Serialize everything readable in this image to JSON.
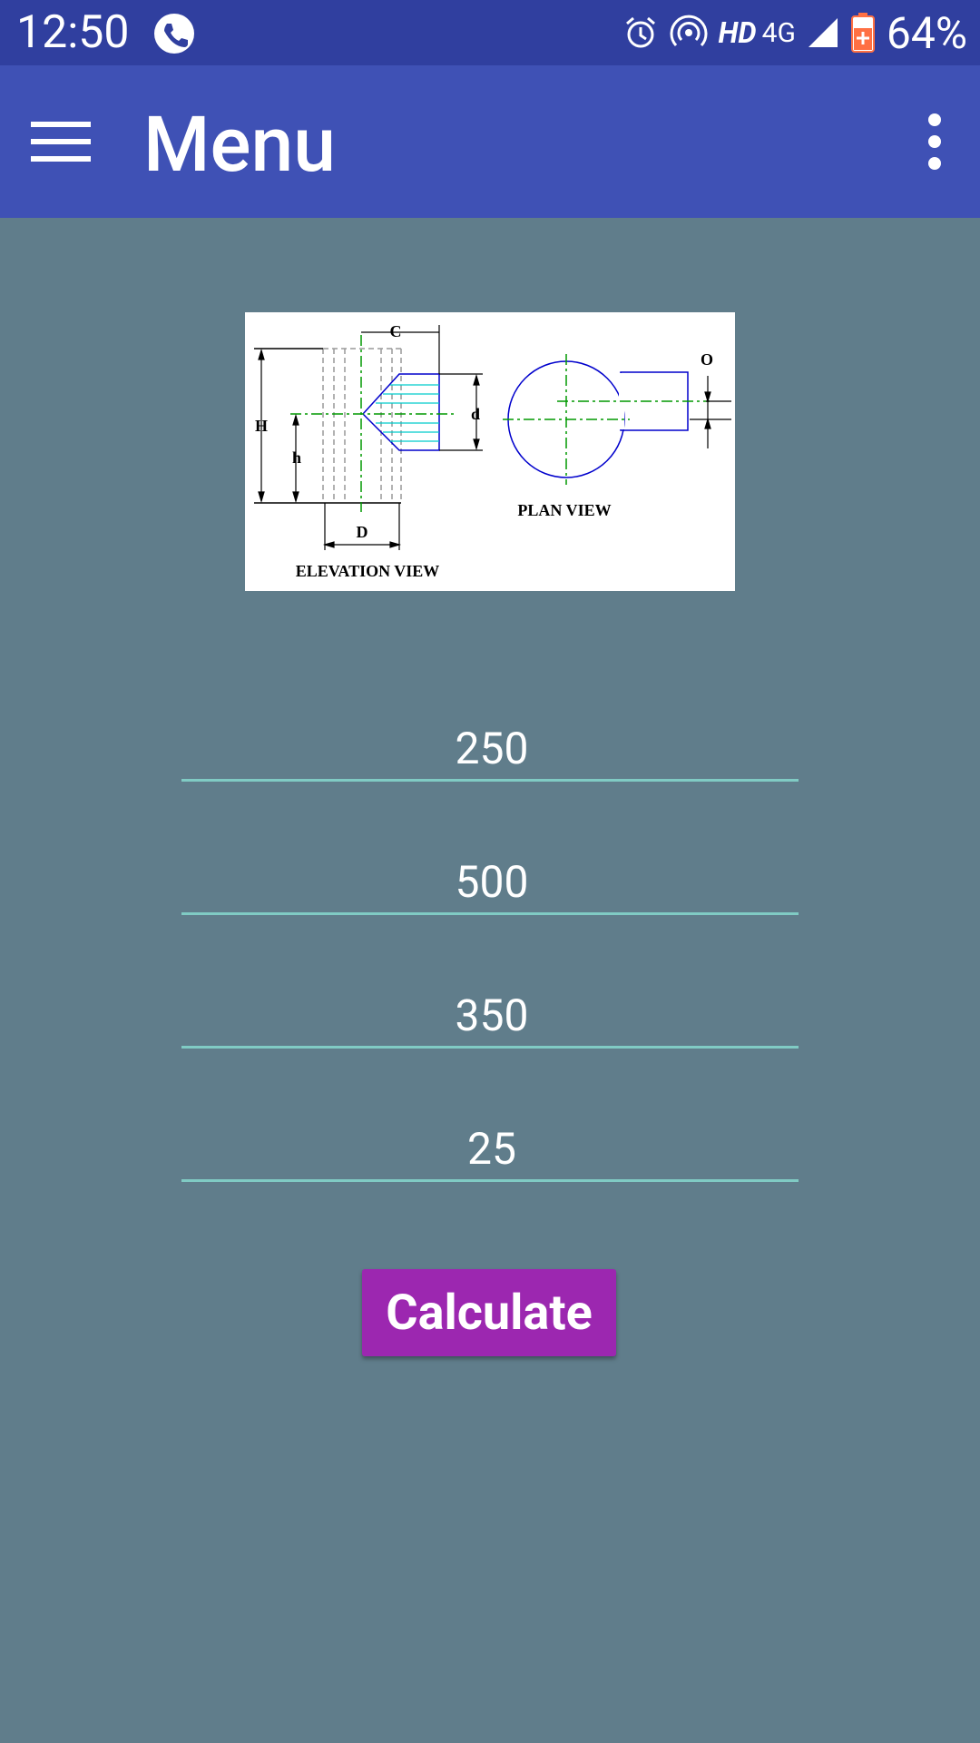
{
  "status_bar": {
    "time": "12:50",
    "network_label_hd": "HD",
    "network_label_4g": "4G",
    "battery_percent": "64%",
    "icons": [
      "phone-icon",
      "alarm-icon",
      "hotspot-icon",
      "signal-icon",
      "battery-icon"
    ]
  },
  "app_bar": {
    "title": "Menu",
    "icons": [
      "hamburger-menu-icon",
      "overflow-menu-icon"
    ]
  },
  "diagram": {
    "labels": {
      "c": "C",
      "h_upper": "H",
      "h_lower": "h",
      "d_lower": "d",
      "d_upper": "D",
      "o": "O",
      "plan_view": "PLAN VIEW",
      "elevation_view": "ELEVATION VIEW"
    }
  },
  "fields": [
    {
      "value": "250"
    },
    {
      "value": "500"
    },
    {
      "value": "350"
    },
    {
      "value": "25"
    }
  ],
  "calculate_button": {
    "label": "Calculate"
  },
  "colors": {
    "status_bar": "#303f9f",
    "app_bar": "#3f51b5",
    "background": "#607d8b",
    "underline": "#80cbc4",
    "button": "#9c27b0"
  }
}
